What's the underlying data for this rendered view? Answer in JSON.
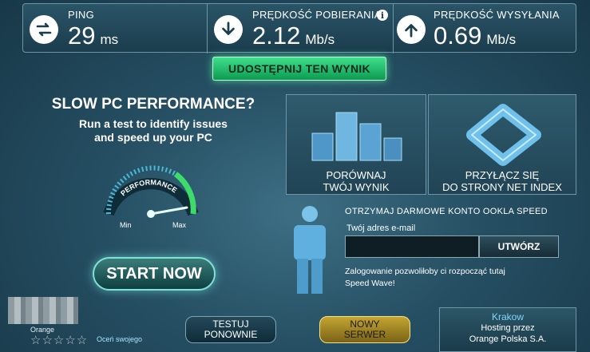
{
  "stats": {
    "ping": {
      "label": "PING",
      "value": "29",
      "unit": "ms"
    },
    "download": {
      "label": "PRĘDKOŚĆ POBIERANIA",
      "value": "2.12",
      "unit": "Mb/s"
    },
    "upload": {
      "label": "PRĘDKOŚĆ WYSYŁANIA",
      "value": "0.69",
      "unit": "Mb/s"
    }
  },
  "share_button": "UDOSTĘPNIJ TEN WYNIK",
  "ad": {
    "title": "SLOW PC PERFORMANCE?",
    "subtitle_line1": "Run a test to identify issues",
    "subtitle_line2": "and speed up your PC",
    "gauge_label": "PERFORMANCE",
    "gauge_min": "Min",
    "gauge_max": "Max",
    "start_button": "START NOW"
  },
  "compare": {
    "line1": "PORÓWNAJ",
    "line2": "TWÓJ WYNIK"
  },
  "net_index": {
    "line1": "PRZYŁĄCZ SIĘ",
    "line2": "DO STRONY NET INDEX"
  },
  "ookla": {
    "title": "OTRZYMAJ DARMOWE KONTO OOKLA SPEED",
    "email_label": "Twój adres e-mail",
    "email_value": "",
    "create_button": "UTWÓRZ",
    "note_line1": "Zalogowanie pozwoliłoby ci rozpocząć tutaj",
    "note_line2": "Speed Wave!"
  },
  "bottom": {
    "isp_name": "Orange",
    "rating_stars": "☆☆☆☆☆",
    "rate_link": "Oceń swojego",
    "retest_line1": "TESTUJ",
    "retest_line2": "PONOWNIE",
    "new_server_line1": "NOWY",
    "new_server_line2": "SERWER",
    "server_city": "Krakow",
    "server_host_line1": "Hosting przez",
    "server_host_line2": "Orange Polska S.A."
  },
  "colors": {
    "accent_green": "#1fc46e",
    "accent_gold": "#c4a632",
    "background": "#264f63"
  },
  "icons": [
    "exchange-arrows-icon",
    "download-arrow-icon",
    "upload-arrow-icon",
    "info-icon"
  ]
}
